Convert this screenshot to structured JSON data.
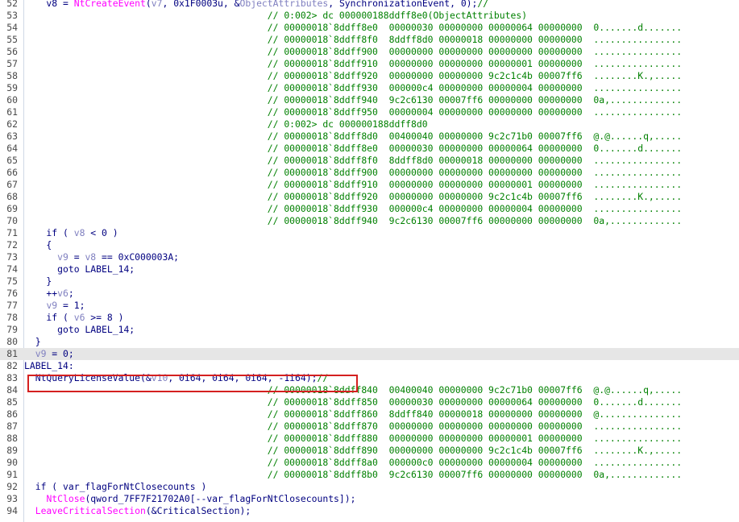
{
  "editor": {
    "lines": [
      {
        "n": "52",
        "tokens": [
          {
            "t": "    v8 = ",
            "c": "plain"
          },
          {
            "t": "NtCreateEvent",
            "c": "func"
          },
          {
            "t": "(",
            "c": "plain"
          },
          {
            "t": "v7",
            "c": "var"
          },
          {
            "t": ", ",
            "c": "plain"
          },
          {
            "t": "0x1F0003u",
            "c": "plain"
          },
          {
            "t": ", &",
            "c": "plain"
          },
          {
            "t": "ObjectAttributes",
            "c": "var"
          },
          {
            "t": ", SynchronizationEvent, 0);",
            "c": "plain"
          },
          {
            "t": "//",
            "c": "comment"
          }
        ]
      },
      {
        "n": "53",
        "tokens": [
          {
            "t": "                                            // 0:002> dc 000000188ddff8e0(ObjectAttributes)",
            "c": "comment"
          }
        ]
      },
      {
        "n": "54",
        "tokens": [
          {
            "t": "                                            // 00000018`8ddff8e0  00000030 00000000 00000064 00000000  0.......d.......",
            "c": "comment"
          }
        ]
      },
      {
        "n": "55",
        "tokens": [
          {
            "t": "                                            // 00000018`8ddff8f0  8ddff8d0 00000018 00000000 00000000  ................",
            "c": "comment"
          }
        ]
      },
      {
        "n": "56",
        "tokens": [
          {
            "t": "                                            // 00000018`8ddff900  00000000 00000000 00000000 00000000  ................",
            "c": "comment"
          }
        ]
      },
      {
        "n": "57",
        "tokens": [
          {
            "t": "                                            // 00000018`8ddff910  00000000 00000000 00000001 00000000  ................",
            "c": "comment"
          }
        ]
      },
      {
        "n": "58",
        "tokens": [
          {
            "t": "                                            // 00000018`8ddff920  00000000 00000000 9c2c1c4b 00007ff6  ........K.,.....",
            "c": "comment"
          }
        ]
      },
      {
        "n": "59",
        "tokens": [
          {
            "t": "                                            // 00000018`8ddff930  000000c4 00000000 00000004 00000000  ................",
            "c": "comment"
          }
        ]
      },
      {
        "n": "60",
        "tokens": [
          {
            "t": "                                            // 00000018`8ddff940  9c2c6130 00007ff6 00000000 00000000  0a,.............",
            "c": "comment"
          }
        ]
      },
      {
        "n": "61",
        "tokens": [
          {
            "t": "                                            // 00000018`8ddff950  00000004 00000000 00000000 00000000  ................",
            "c": "comment"
          }
        ]
      },
      {
        "n": "62",
        "tokens": [
          {
            "t": "                                            // 0:002> dc 000000188ddff8d0",
            "c": "comment"
          }
        ]
      },
      {
        "n": "63",
        "tokens": [
          {
            "t": "                                            // 00000018`8ddff8d0  00400040 00000000 9c2c71b0 00007ff6  @.@......q,.....",
            "c": "comment"
          }
        ]
      },
      {
        "n": "64",
        "tokens": [
          {
            "t": "                                            // 00000018`8ddff8e0  00000030 00000000 00000064 00000000  0.......d.......",
            "c": "comment"
          }
        ]
      },
      {
        "n": "65",
        "tokens": [
          {
            "t": "                                            // 00000018`8ddff8f0  8ddff8d0 00000018 00000000 00000000  ................",
            "c": "comment"
          }
        ]
      },
      {
        "n": "66",
        "tokens": [
          {
            "t": "                                            // 00000018`8ddff900  00000000 00000000 00000000 00000000  ................",
            "c": "comment"
          }
        ]
      },
      {
        "n": "67",
        "tokens": [
          {
            "t": "                                            // 00000018`8ddff910  00000000 00000000 00000001 00000000  ................",
            "c": "comment"
          }
        ]
      },
      {
        "n": "68",
        "tokens": [
          {
            "t": "                                            // 00000018`8ddff920  00000000 00000000 9c2c1c4b 00007ff6  ........K.,.....",
            "c": "comment"
          }
        ]
      },
      {
        "n": "69",
        "tokens": [
          {
            "t": "                                            // 00000018`8ddff930  000000c4 00000000 00000004 00000000  ................",
            "c": "comment"
          }
        ]
      },
      {
        "n": "70",
        "tokens": [
          {
            "t": "                                            // 00000018`8ddff940  9c2c6130 00007ff6 00000000 00000000  0a,.............",
            "c": "comment"
          }
        ]
      },
      {
        "n": "71",
        "tokens": [
          {
            "t": "    if ( ",
            "c": "plain"
          },
          {
            "t": "v8",
            "c": "var"
          },
          {
            "t": " < 0 )",
            "c": "plain"
          }
        ]
      },
      {
        "n": "72",
        "tokens": [
          {
            "t": "    {",
            "c": "plain"
          }
        ]
      },
      {
        "n": "73",
        "tokens": [
          {
            "t": "      ",
            "c": "plain"
          },
          {
            "t": "v9",
            "c": "var"
          },
          {
            "t": " = ",
            "c": "plain"
          },
          {
            "t": "v8",
            "c": "var"
          },
          {
            "t": " == 0xC000003A;",
            "c": "plain"
          }
        ]
      },
      {
        "n": "74",
        "tokens": [
          {
            "t": "      goto LABEL_14;",
            "c": "plain"
          }
        ]
      },
      {
        "n": "75",
        "tokens": [
          {
            "t": "    }",
            "c": "plain"
          }
        ]
      },
      {
        "n": "76",
        "tokens": [
          {
            "t": "    ++",
            "c": "plain"
          },
          {
            "t": "v6",
            "c": "var"
          },
          {
            "t": ";",
            "c": "plain"
          }
        ]
      },
      {
        "n": "77",
        "tokens": [
          {
            "t": "    ",
            "c": "plain"
          },
          {
            "t": "v9",
            "c": "var"
          },
          {
            "t": " = 1;",
            "c": "plain"
          }
        ]
      },
      {
        "n": "78",
        "tokens": [
          {
            "t": "    if ( ",
            "c": "plain"
          },
          {
            "t": "v6",
            "c": "var"
          },
          {
            "t": " >= 8 )",
            "c": "plain"
          }
        ]
      },
      {
        "n": "79",
        "tokens": [
          {
            "t": "      goto LABEL_14;",
            "c": "plain"
          }
        ]
      },
      {
        "n": "80",
        "tokens": [
          {
            "t": "  }",
            "c": "plain"
          }
        ]
      },
      {
        "n": "81",
        "highlight": true,
        "tokens": [
          {
            "t": "  ",
            "c": "plain"
          },
          {
            "t": "v9",
            "c": "var"
          },
          {
            "t": " = 0;",
            "c": "plain"
          }
        ]
      },
      {
        "n": "82",
        "tokens": [
          {
            "t": "LABEL_14:",
            "c": "label"
          }
        ]
      },
      {
        "n": "83",
        "tokens": [
          {
            "t": "  NtQueryLicenseValue(&",
            "c": "plain"
          },
          {
            "t": "v10",
            "c": "var"
          },
          {
            "t": ", 0i64, 0i64, 0i64, -1i64);",
            "c": "plain"
          },
          {
            "t": "//",
            "c": "comment"
          }
        ]
      },
      {
        "n": "84",
        "tokens": [
          {
            "t": "                                            // 00000018`8ddff840  00400040 00000000 9c2c71b0 00007ff6  @.@......q,.....",
            "c": "comment"
          }
        ]
      },
      {
        "n": "85",
        "tokens": [
          {
            "t": "                                            // 00000018`8ddff850  00000030 00000000 00000064 00000000  0.......d.......",
            "c": "comment"
          }
        ]
      },
      {
        "n": "86",
        "tokens": [
          {
            "t": "                                            // 00000018`8ddff860  8ddff840 00000018 00000000 00000000  @...............",
            "c": "comment"
          }
        ]
      },
      {
        "n": "87",
        "tokens": [
          {
            "t": "                                            // 00000018`8ddff870  00000000 00000000 00000000 00000000  ................",
            "c": "comment"
          }
        ]
      },
      {
        "n": "88",
        "tokens": [
          {
            "t": "                                            // 00000018`8ddff880  00000000 00000000 00000001 00000000  ................",
            "c": "comment"
          }
        ]
      },
      {
        "n": "89",
        "tokens": [
          {
            "t": "                                            // 00000018`8ddff890  00000000 00000000 9c2c1c4b 00007ff6  ........K.,.....",
            "c": "comment"
          }
        ]
      },
      {
        "n": "90",
        "tokens": [
          {
            "t": "                                            // 00000018`8ddff8a0  000000c0 00000000 00000004 00000000  ................",
            "c": "comment"
          }
        ]
      },
      {
        "n": "91",
        "tokens": [
          {
            "t": "                                            // 00000018`8ddff8b0  9c2c6130 00007ff6 00000000 00000000  0a,.............",
            "c": "comment"
          }
        ]
      },
      {
        "n": "92",
        "tokens": [
          {
            "t": "  if ( var_flagForNtClosecounts )",
            "c": "plain"
          }
        ]
      },
      {
        "n": "93",
        "tokens": [
          {
            "t": "    ",
            "c": "plain"
          },
          {
            "t": "NtClose",
            "c": "func"
          },
          {
            "t": "(qword_7FF7F21702A0[--var_flagForNtClosecounts]);",
            "c": "plain"
          }
        ]
      },
      {
        "n": "94",
        "tokens": [
          {
            "t": "  ",
            "c": "plain"
          },
          {
            "t": "LeaveCriticalSection",
            "c": "func"
          },
          {
            "t": "(&CriticalSection);",
            "c": "plain"
          }
        ]
      }
    ],
    "colors": {
      "plain": "#000080",
      "func": "#ff00ff",
      "var": "#8080c0",
      "comment": "#008000",
      "highlight_bg": "#e6e6e6",
      "selection_border": "#d42020"
    }
  }
}
